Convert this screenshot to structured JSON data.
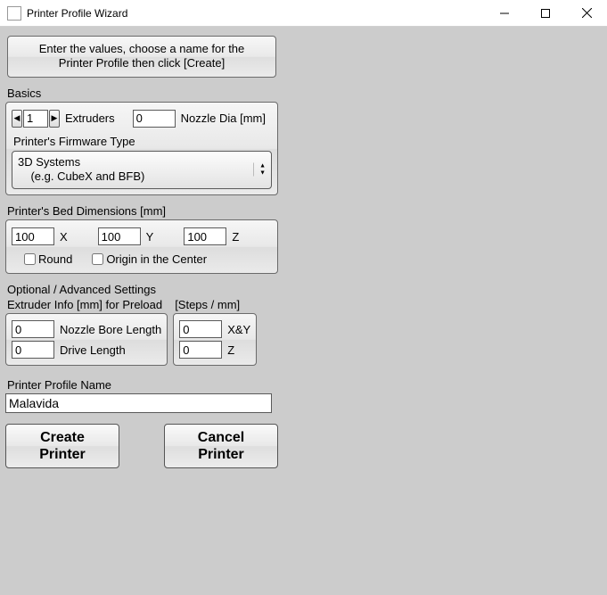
{
  "window": {
    "title": "Printer Profile Wizard"
  },
  "banner": {
    "line1": "Enter the values, choose a name for the",
    "line2": "Printer Profile then click [Create]"
  },
  "basics": {
    "label": "Basics",
    "extruders_value": "1",
    "extruders_label": "Extruders",
    "nozzle_dia_value": "0",
    "nozzle_dia_label": "Nozzle Dia [mm]",
    "firmware_label": "Printer's Firmware Type",
    "firmware_line1": "3D Systems",
    "firmware_line2": "    (e.g. CubeX and BFB)"
  },
  "bed": {
    "label": "Printer's Bed Dimensions [mm]",
    "x_value": "100",
    "x_label": "X",
    "y_value": "100",
    "y_label": "Y",
    "z_value": "100",
    "z_label": "Z",
    "round_label": "Round",
    "origin_label": "Origin in the Center"
  },
  "adv": {
    "label": "Optional / Advanced Settings",
    "extruder_info_label": "Extruder Info [mm] for Preload",
    "steps_label": "[Steps / mm]",
    "nozzle_bore_value": "0",
    "nozzle_bore_label": "Nozzle Bore Length",
    "drive_value": "0",
    "drive_label": "Drive Length",
    "xy_value": "0",
    "xy_label": "X&Y",
    "z_value": "0",
    "z_label": "Z"
  },
  "profile": {
    "label": "Printer Profile Name",
    "value": "Malavida"
  },
  "buttons": {
    "create": "Create\nPrinter",
    "cancel": "Cancel\nPrinter"
  }
}
